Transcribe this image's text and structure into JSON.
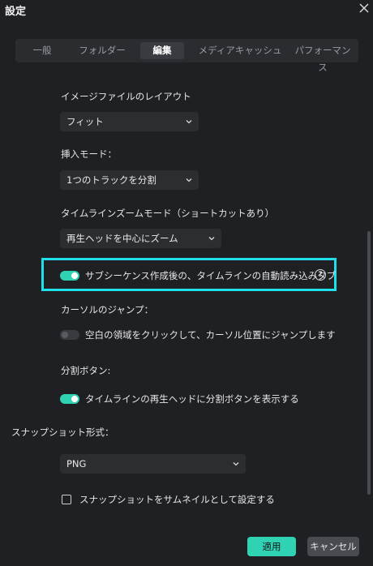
{
  "window": {
    "title": "設定"
  },
  "tabs": [
    {
      "label": "一般",
      "active": false
    },
    {
      "label": "フォルダー",
      "active": false
    },
    {
      "label": "編集",
      "active": true
    },
    {
      "label": "メディアキャッシュ",
      "active": false
    },
    {
      "label": "パフォーマンス",
      "active": false
    }
  ],
  "image_layout": {
    "label": "イメージファイルのレイアウト",
    "value": "フィット"
  },
  "insert_mode": {
    "label": "挿入モード：",
    "value": "1つのトラックを分割"
  },
  "timeline_zoom": {
    "label": "タイムラインズームモード（ショートカットあり）",
    "value": "再生ヘッドを中心にズーム"
  },
  "subsequence_toggle": {
    "label": "サブシーケンス作成後の、タイムラインの自動読み込みタブ",
    "on": true,
    "help": "?"
  },
  "cursor_jump": {
    "label": "カーソルのジャンプ：",
    "toggle_label": "空白の領域をクリックして、カーソル位置にジャンプします",
    "on": false
  },
  "split_button": {
    "label": "分割ボタン:",
    "toggle_label": "タイムラインの再生ヘッドに分割ボタンを表示する",
    "on": true
  },
  "snapshot_format": {
    "label": "スナップショット形式：",
    "value": "PNG"
  },
  "snapshot_thumbnail": {
    "label": "スナップショットをサムネイルとして設定する",
    "checked": false
  },
  "footer": {
    "apply": "適用",
    "cancel": "キャンセル"
  },
  "colors": {
    "accent": "#2fd3b4",
    "highlight": "#1fe0ea",
    "background": "#1f2023"
  }
}
